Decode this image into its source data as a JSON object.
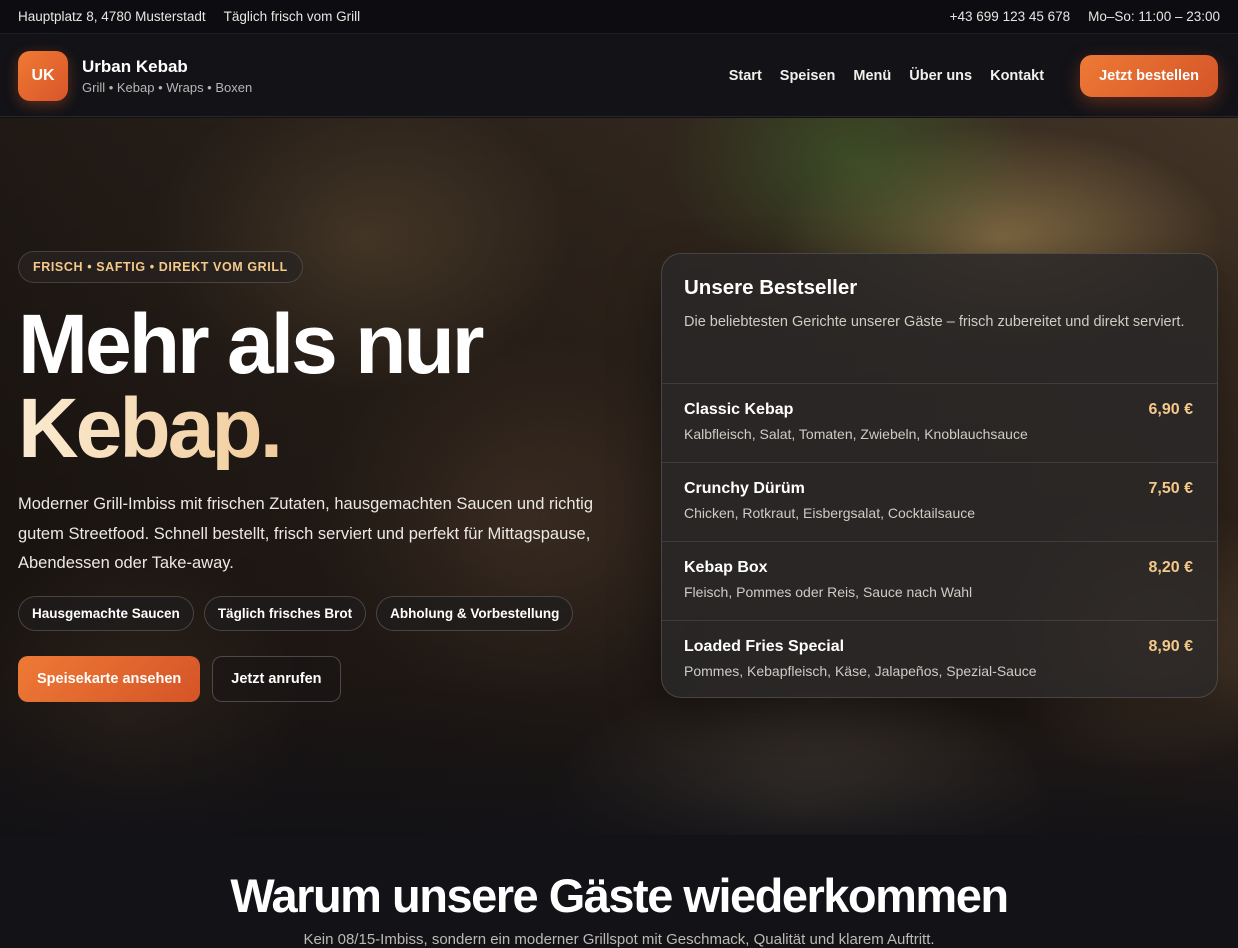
{
  "topbar": {
    "address": "Hauptplatz 8, 4780 Musterstadt",
    "tagline": "Täglich frisch vom Grill",
    "phone": "+43 699 123 45 678",
    "hours": "Mo–So: 11:00 – 23:00"
  },
  "nav": {
    "logo_initials": "UK",
    "brand_name": "Urban Kebab",
    "brand_tag": "Grill • Kebap • Wraps • Boxen",
    "items": [
      "Start",
      "Speisen",
      "Menü",
      "Über uns",
      "Kontakt"
    ],
    "order_label": "Jetzt bestellen"
  },
  "hero": {
    "eyebrow": "FRISCH • SAFTIG • DIREKT VOM GRILL",
    "headline_line1": "Mehr als nur",
    "headline_accent": "Kebap.",
    "lead": "Moderner Grill-Imbiss mit frischen Zutaten, hausgemachten Saucen und richtig gutem Streetfood. Schnell bestellt, frisch serviert und perfekt für Mittagspause, Abendessen oder Take-away.",
    "chips": [
      "Hausgemachte Saucen",
      "Täglich frisches Brot",
      "Abholung & Vorbestellung"
    ],
    "cta_primary": "Speisekarte ansehen",
    "cta_secondary": "Jetzt anrufen"
  },
  "bestseller": {
    "title": "Unsere Bestseller",
    "subtitle": "Die beliebtesten Gerichte unserer Gäste – frisch zubereitet und direkt serviert.",
    "items": [
      {
        "name": "Classic Kebap",
        "desc": "Kalbfleisch, Salat, Tomaten, Zwiebeln, Knoblauchsauce",
        "price": "6,90 €"
      },
      {
        "name": "Crunchy Dürüm",
        "desc": "Chicken, Rotkraut, Eisbergsalat, Cocktailsauce",
        "price": "7,50 €"
      },
      {
        "name": "Kebap Box",
        "desc": "Fleisch, Pommes oder Reis, Sauce nach Wahl",
        "price": "8,20 €"
      },
      {
        "name": "Loaded Fries Special",
        "desc": "Pommes, Kebapfleisch, Käse, Jalapeños, Spezial-Sauce",
        "price": "8,90 €"
      }
    ]
  },
  "why": {
    "title": "Warum unsere Gäste wiederkommen",
    "subtitle": "Kein 08/15-Imbiss, sondern ein moderner Grillspot mit Geschmack, Qualität und klarem Auftritt."
  },
  "colors": {
    "accent": "#e8652e",
    "gold": "#f4c98a",
    "background": "#111116"
  }
}
